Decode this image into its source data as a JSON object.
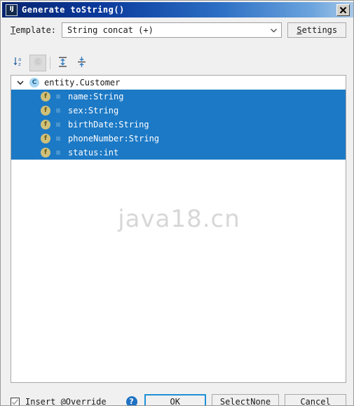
{
  "window": {
    "app_icon": "IJ",
    "title": "Generate toString()",
    "close_label": "close-icon"
  },
  "template_row": {
    "label_prefix": "T",
    "label_rest": "emplate:",
    "value": "String concat (+)",
    "dropdown_icon": "chevron-down-icon",
    "settings_prefix": "S",
    "settings_rest": "ettings"
  },
  "toolbar": {
    "buttons": [
      {
        "name": "sort-alphabetically-button",
        "icon": "sort-az-icon",
        "state": "enabled"
      },
      {
        "name": "sort-by-type-button",
        "icon": "circle-c-icon",
        "state": "disabled-pressed"
      },
      {
        "name": "expand-all-button",
        "icon": "expand-all-icon",
        "state": "enabled"
      },
      {
        "name": "collapse-all-button",
        "icon": "collapse-all-icon",
        "state": "enabled"
      }
    ]
  },
  "tree": {
    "root": {
      "twisty": "chevron-down-icon",
      "icon": "class-icon",
      "icon_letter": "C",
      "label": "entity.Customer",
      "expanded": true
    },
    "fields": [
      {
        "icon_letter": "f",
        "label": "name:String",
        "selected": true
      },
      {
        "icon_letter": "f",
        "label": "sex:String",
        "selected": true
      },
      {
        "icon_letter": "f",
        "label": "birthDate:String",
        "selected": true
      },
      {
        "icon_letter": "f",
        "label": "phoneNumber:String",
        "selected": true
      },
      {
        "icon_letter": "f",
        "label": "status:int",
        "selected": true
      }
    ]
  },
  "watermark": {
    "text": "java18.cn"
  },
  "footer": {
    "checkbox": {
      "checked": true,
      "label_a": "Insert @",
      "label_mnemonic": "O",
      "label_b": "verride"
    },
    "help_label": "?",
    "ok_label": "OK",
    "select_none_a": "Select ",
    "select_none_mnemonic": "N",
    "select_none_b": "one",
    "cancel_label": "Cancel"
  },
  "colors": {
    "selection_blue": "#1c79c5",
    "title_blue": "#0a3a9c",
    "focus_blue": "#1f8fd6",
    "help_blue": "#1f73c4",
    "field_icon": "#cfc07a",
    "class_icon": "#a9d7f2",
    "watermark_gray": "#d7d7d7"
  }
}
